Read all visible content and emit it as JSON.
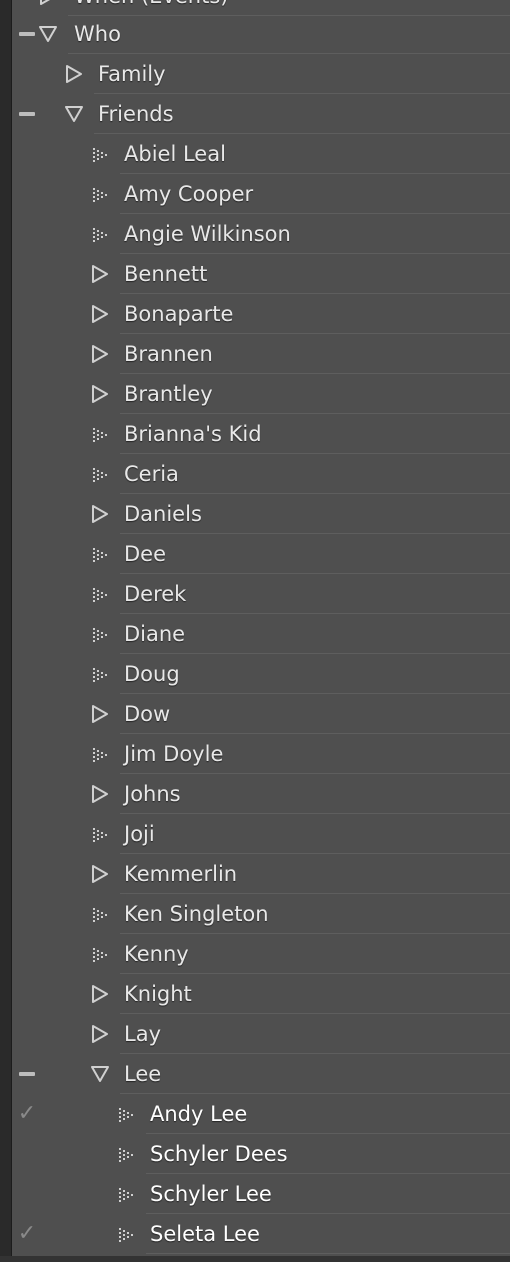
{
  "colors": {
    "panel_bg": "#4f4f4f",
    "row_divider": "#5e5e5e",
    "text": "#e8e8e8",
    "icon": "#d0d0d0"
  },
  "top_cut": {
    "label": "When (Events)",
    "icon": "triangle-right-icon"
  },
  "rows": [
    {
      "label": "Who",
      "level": 0,
      "icon": "triangle-down-icon",
      "gutter": "dash"
    },
    {
      "label": "Family",
      "level": 1,
      "icon": "triangle-right-icon",
      "gutter": ""
    },
    {
      "label": "Friends",
      "level": 1,
      "icon": "triangle-down-icon",
      "gutter": "dash"
    },
    {
      "label": "Abiel Leal",
      "level": 2,
      "icon": "keyword-leaf-icon",
      "gutter": ""
    },
    {
      "label": "Amy Cooper",
      "level": 2,
      "icon": "keyword-leaf-icon",
      "gutter": ""
    },
    {
      "label": "Angie Wilkinson",
      "level": 2,
      "icon": "keyword-leaf-icon",
      "gutter": ""
    },
    {
      "label": "Bennett",
      "level": 2,
      "icon": "triangle-right-icon",
      "gutter": ""
    },
    {
      "label": "Bonaparte",
      "level": 2,
      "icon": "triangle-right-icon",
      "gutter": ""
    },
    {
      "label": "Brannen",
      "level": 2,
      "icon": "triangle-right-icon",
      "gutter": ""
    },
    {
      "label": "Brantley",
      "level": 2,
      "icon": "triangle-right-icon",
      "gutter": ""
    },
    {
      "label": "Brianna's Kid",
      "level": 2,
      "icon": "keyword-leaf-icon",
      "gutter": ""
    },
    {
      "label": "Ceria",
      "level": 2,
      "icon": "keyword-leaf-icon",
      "gutter": ""
    },
    {
      "label": "Daniels",
      "level": 2,
      "icon": "triangle-right-icon",
      "gutter": ""
    },
    {
      "label": "Dee",
      "level": 2,
      "icon": "keyword-leaf-icon",
      "gutter": ""
    },
    {
      "label": "Derek",
      "level": 2,
      "icon": "keyword-leaf-icon",
      "gutter": ""
    },
    {
      "label": "Diane",
      "level": 2,
      "icon": "keyword-leaf-icon",
      "gutter": ""
    },
    {
      "label": "Doug",
      "level": 2,
      "icon": "keyword-leaf-icon",
      "gutter": ""
    },
    {
      "label": "Dow",
      "level": 2,
      "icon": "triangle-right-icon",
      "gutter": ""
    },
    {
      "label": "Jim Doyle",
      "level": 2,
      "icon": "keyword-leaf-icon",
      "gutter": ""
    },
    {
      "label": "Johns",
      "level": 2,
      "icon": "triangle-right-icon",
      "gutter": ""
    },
    {
      "label": "Joji",
      "level": 2,
      "icon": "keyword-leaf-icon",
      "gutter": ""
    },
    {
      "label": "Kemmerlin",
      "level": 2,
      "icon": "triangle-right-icon",
      "gutter": ""
    },
    {
      "label": "Ken Singleton",
      "level": 2,
      "icon": "keyword-leaf-icon",
      "gutter": ""
    },
    {
      "label": "Kenny",
      "level": 2,
      "icon": "keyword-leaf-icon",
      "gutter": ""
    },
    {
      "label": "Knight",
      "level": 2,
      "icon": "triangle-right-icon",
      "gutter": ""
    },
    {
      "label": "Lay",
      "level": 2,
      "icon": "triangle-right-icon",
      "gutter": ""
    },
    {
      "label": "Lee",
      "level": 2,
      "icon": "triangle-down-icon",
      "gutter": "dash"
    },
    {
      "label": "Andy Lee",
      "level": 3,
      "icon": "keyword-leaf-icon",
      "gutter": "check"
    },
    {
      "label": "Schyler Dees",
      "level": 3,
      "icon": "keyword-leaf-icon",
      "gutter": ""
    },
    {
      "label": "Schyler Lee",
      "level": 3,
      "icon": "keyword-leaf-icon",
      "gutter": ""
    },
    {
      "label": "Seleta Lee",
      "level": 3,
      "icon": "keyword-leaf-icon",
      "gutter": "check"
    }
  ]
}
